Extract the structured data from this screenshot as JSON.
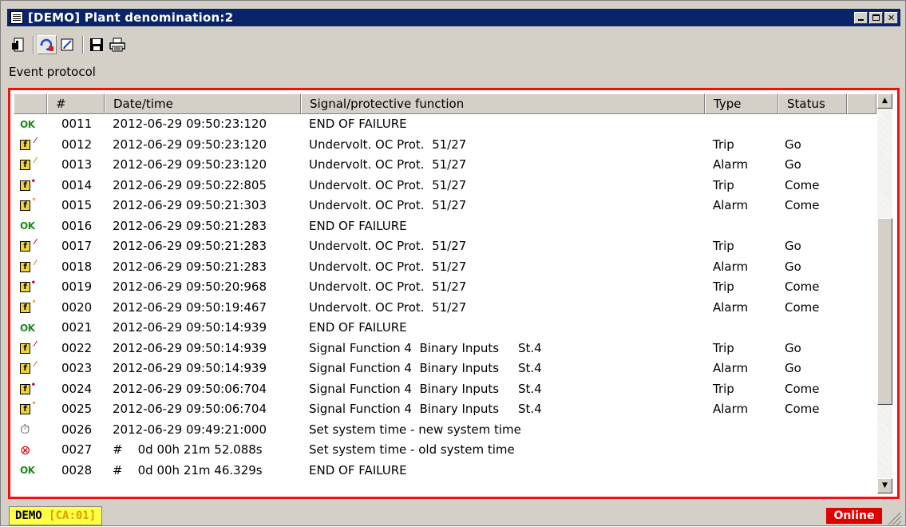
{
  "window": {
    "title": "[DEMO]  Plant denomination:2"
  },
  "toolbar": {
    "icons": [
      "exit-icon",
      "refresh-icon",
      "edit-icon",
      "save-icon",
      "print-icon"
    ]
  },
  "section_label": "Event protocol",
  "table": {
    "headers": [
      "#",
      "Date/time",
      "Signal/protective function",
      "Type",
      "Status"
    ],
    "rows": [
      {
        "icon": "ok",
        "num": "0011",
        "datetime": "2012-06-29 09:50:23:120",
        "signal": "END OF FAILURE",
        "type": "",
        "status": ""
      },
      {
        "icon": "fault-go",
        "num": "0012",
        "datetime": "2012-06-29 09:50:23:120",
        "signal": "Undervolt. OC Prot.  51/27",
        "type": "Trip",
        "status": "Go"
      },
      {
        "icon": "fault-go-alarm",
        "num": "0013",
        "datetime": "2012-06-29 09:50:23:120",
        "signal": "Undervolt. OC Prot.  51/27",
        "type": "Alarm",
        "status": "Go"
      },
      {
        "icon": "fault-come",
        "num": "0014",
        "datetime": "2012-06-29 09:50:22:805",
        "signal": "Undervolt. OC Prot.  51/27",
        "type": "Trip",
        "status": "Come"
      },
      {
        "icon": "fault-come-alarm",
        "num": "0015",
        "datetime": "2012-06-29 09:50:21:303",
        "signal": "Undervolt. OC Prot.  51/27",
        "type": "Alarm",
        "status": "Come"
      },
      {
        "icon": "ok",
        "num": "0016",
        "datetime": "2012-06-29 09:50:21:283",
        "signal": "END OF FAILURE",
        "type": "",
        "status": ""
      },
      {
        "icon": "fault-go",
        "num": "0017",
        "datetime": "2012-06-29 09:50:21:283",
        "signal": "Undervolt. OC Prot.  51/27",
        "type": "Trip",
        "status": "Go"
      },
      {
        "icon": "fault-go-alarm",
        "num": "0018",
        "datetime": "2012-06-29 09:50:21:283",
        "signal": "Undervolt. OC Prot.  51/27",
        "type": "Alarm",
        "status": "Go"
      },
      {
        "icon": "fault-come",
        "num": "0019",
        "datetime": "2012-06-29 09:50:20:968",
        "signal": "Undervolt. OC Prot.  51/27",
        "type": "Trip",
        "status": "Come"
      },
      {
        "icon": "fault-come-alarm",
        "num": "0020",
        "datetime": "2012-06-29 09:50:19:467",
        "signal": "Undervolt. OC Prot.  51/27",
        "type": "Alarm",
        "status": "Come"
      },
      {
        "icon": "ok",
        "num": "0021",
        "datetime": "2012-06-29 09:50:14:939",
        "signal": "END OF FAILURE",
        "type": "",
        "status": ""
      },
      {
        "icon": "fault-go",
        "num": "0022",
        "datetime": "2012-06-29 09:50:14:939",
        "signal": "Signal Function 4  Binary Inputs     St.4",
        "type": "Trip",
        "status": "Go"
      },
      {
        "icon": "fault-go-alarm",
        "num": "0023",
        "datetime": "2012-06-29 09:50:14:939",
        "signal": "Signal Function 4  Binary Inputs     St.4",
        "type": "Alarm",
        "status": "Go"
      },
      {
        "icon": "fault-come",
        "num": "0024",
        "datetime": "2012-06-29 09:50:06:704",
        "signal": "Signal Function 4  Binary Inputs     St.4",
        "type": "Trip",
        "status": "Come"
      },
      {
        "icon": "fault-come-alarm",
        "num": "0025",
        "datetime": "2012-06-29 09:50:06:704",
        "signal": "Signal Function 4  Binary Inputs     St.4",
        "type": "Alarm",
        "status": "Come"
      },
      {
        "icon": "clock",
        "num": "0026",
        "datetime": "2012-06-29 09:49:21:000",
        "signal": "Set system time - new system time",
        "type": "",
        "status": ""
      },
      {
        "icon": "clock-old",
        "num": "0027",
        "datetime": "#    0d 00h 21m 52.088s",
        "signal": "Set system time - old system time",
        "type": "",
        "status": ""
      },
      {
        "icon": "ok",
        "num": "0028",
        "datetime": "#    0d 00h 21m 46.329s",
        "signal": "END OF FAILURE",
        "type": "",
        "status": ""
      }
    ]
  },
  "icon_glyphs": {
    "ok": "OK",
    "fault": "f"
  },
  "statusbar": {
    "demo": "DEMO",
    "ca": "[CA:01]",
    "online": "Online"
  },
  "colors": {
    "titlebar": "#0a246a",
    "frame": "#ee1111",
    "ok": "#1d8a1d",
    "online": "#e00000",
    "demo_bg": "#ffff44"
  }
}
